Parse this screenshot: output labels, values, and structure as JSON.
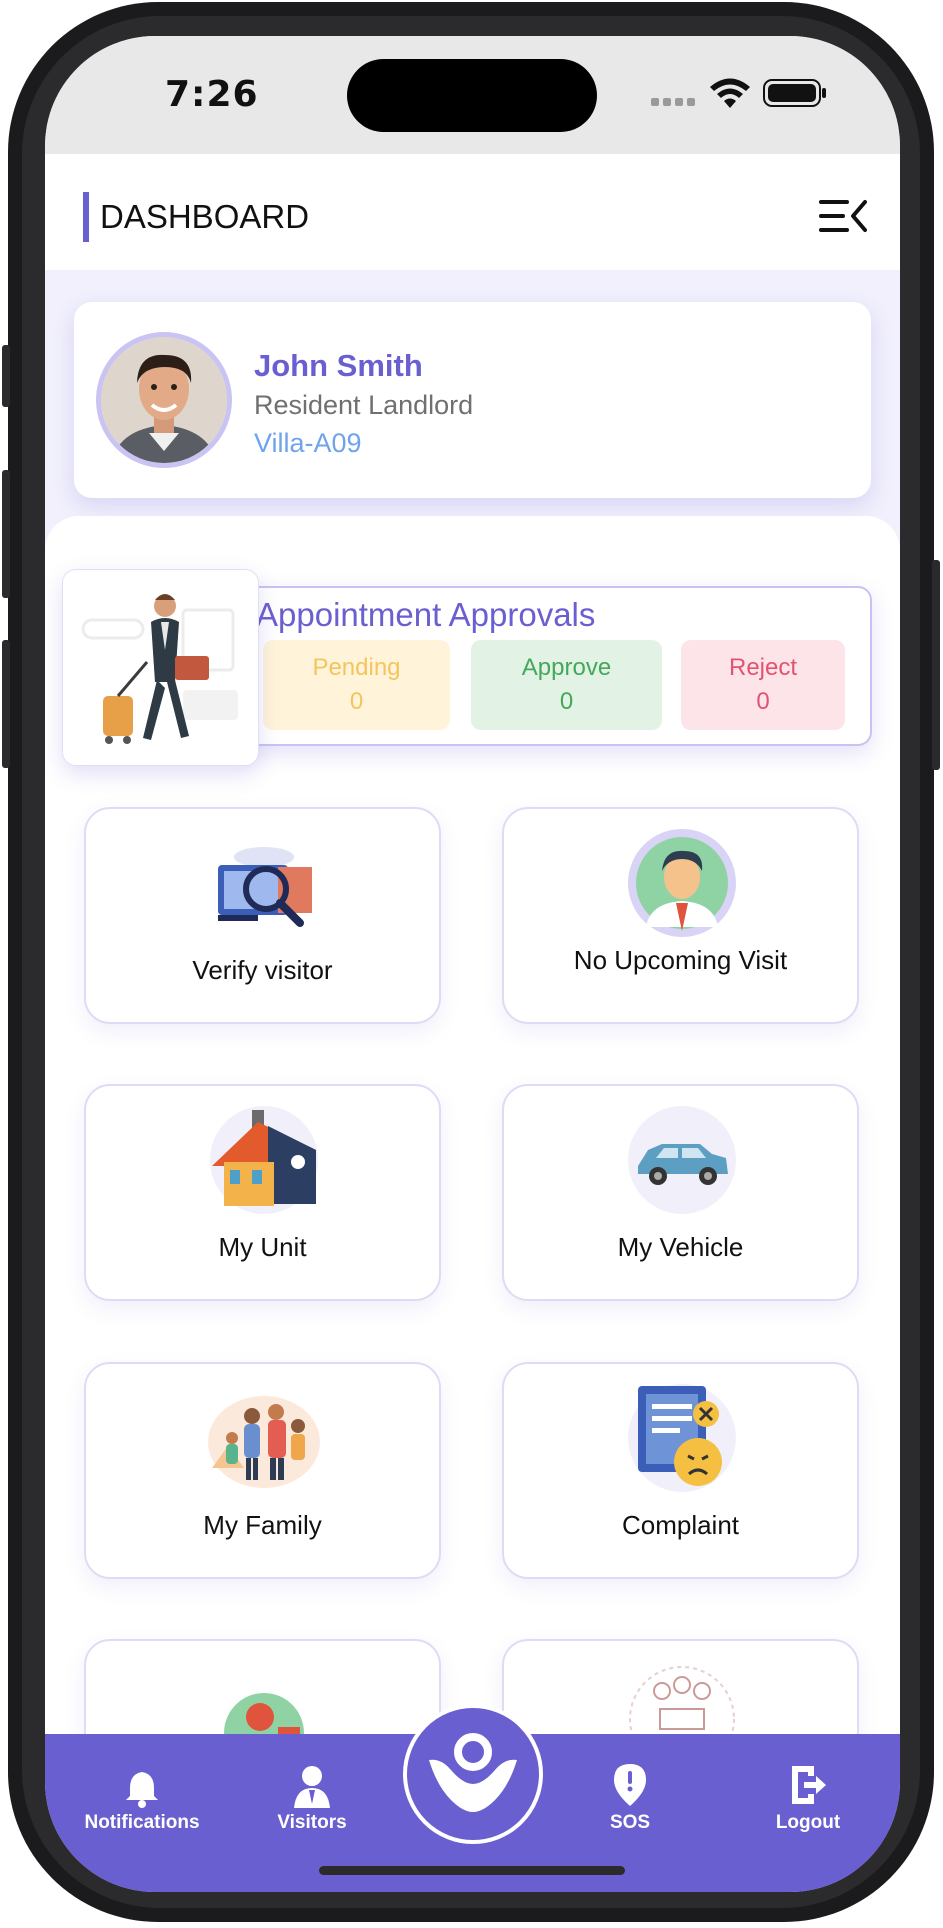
{
  "status_bar": {
    "time": "7:26"
  },
  "header": {
    "title": "DASHBOARD"
  },
  "profile": {
    "name": "John Smith",
    "role": "Resident Landlord",
    "unit": "Villa-A09"
  },
  "appointments": {
    "title": "Appointment Approvals",
    "pending": {
      "label": "Pending",
      "count": "0"
    },
    "approve": {
      "label": "Approve",
      "count": "0"
    },
    "reject": {
      "label": "Reject",
      "count": "0"
    }
  },
  "tiles": [
    {
      "label": "Verify visitor",
      "icon": "verify-visitor-icon"
    },
    {
      "label": "No Upcoming Visit",
      "icon": "visitor-avatar-icon"
    },
    {
      "label": "My Unit",
      "icon": "house-icon"
    },
    {
      "label": "My Vehicle",
      "icon": "car-icon"
    },
    {
      "label": "My Family",
      "icon": "family-icon"
    },
    {
      "label": "Complaint",
      "icon": "complaint-icon"
    }
  ],
  "bottom_nav": {
    "notifications": "Notifications",
    "visitors": "Visitors",
    "sos": "SOS",
    "logout": "Logout"
  },
  "colors": {
    "accent": "#6a5fd1",
    "pending": "#f3c55c",
    "approve": "#43a85a",
    "reject": "#e25370",
    "unit_text": "#6fa3ee"
  }
}
